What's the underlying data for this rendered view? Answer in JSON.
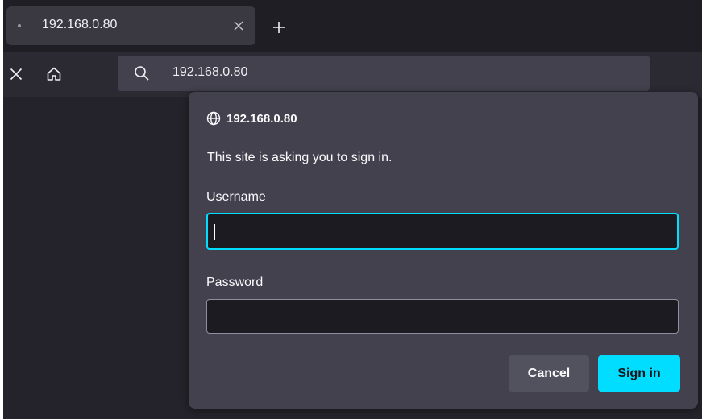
{
  "tab": {
    "title": "192.168.0.80",
    "close_icon": "close-icon",
    "new_tab_icon": "plus-icon"
  },
  "navbar": {
    "stop_icon": "close-icon",
    "home_icon": "home-icon",
    "search_icon": "search-icon",
    "url": "192.168.0.80"
  },
  "dialog": {
    "host_icon": "globe-icon",
    "host": "192.168.0.80",
    "message": "This site is asking you to sign in.",
    "username_label": "Username",
    "username_value": "",
    "password_label": "Password",
    "password_value": "",
    "cancel_label": "Cancel",
    "signin_label": "Sign in"
  },
  "colors": {
    "accent": "#00ddff",
    "dialog_bg": "#42414d",
    "input_bg": "#1c1b22",
    "toolbar_bg": "#2b2a33",
    "tabstrip_bg": "#1f1e25"
  }
}
